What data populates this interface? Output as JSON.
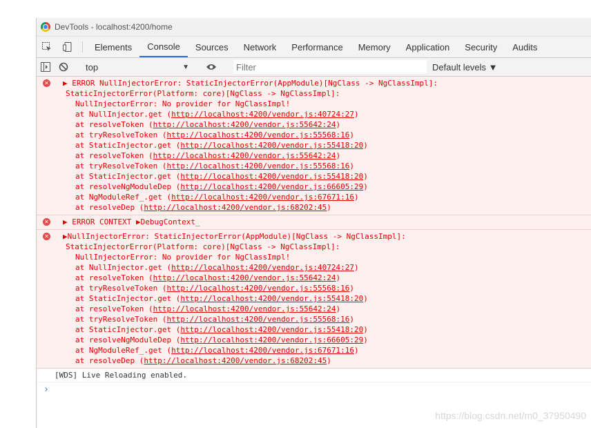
{
  "window": {
    "title": "DevTools - localhost:4200/home"
  },
  "tabs": [
    "Elements",
    "Console",
    "Sources",
    "Network",
    "Performance",
    "Memory",
    "Application",
    "Security",
    "Audits"
  ],
  "active_tab": "Console",
  "toolbar": {
    "context": "top",
    "filter_placeholder": "Filter",
    "levels": "Default levels ▼"
  },
  "messages": [
    {
      "head": "▶ ERROR NullInjectorError: StaticInjectorError(AppModule)[NgClass -> NgClassImpl]:",
      "line2": "StaticInjectorError(Platform: core)[NgClass -> NgClassImpl]:",
      "line3": "NullInjectorError: No provider for NgClassImpl!",
      "stack": [
        {
          "fn": "at NullInjector.get (",
          "url": "http://localhost:4200/vendor.js:40724:27",
          "end": ")"
        },
        {
          "fn": "at resolveToken (",
          "url": "http://localhost:4200/vendor.js:55642:24",
          "end": ")"
        },
        {
          "fn": "at tryResolveToken (",
          "url": "http://localhost:4200/vendor.js:55568:16",
          "end": ")"
        },
        {
          "fn": "at StaticInjector.get (",
          "url": "http://localhost:4200/vendor.js:55418:20",
          "end": ")"
        },
        {
          "fn": "at resolveToken (",
          "url": "http://localhost:4200/vendor.js:55642:24",
          "end": ")"
        },
        {
          "fn": "at tryResolveToken (",
          "url": "http://localhost:4200/vendor.js:55568:16",
          "end": ")"
        },
        {
          "fn": "at StaticInjector.get (",
          "url": "http://localhost:4200/vendor.js:55418:20",
          "end": ")"
        },
        {
          "fn": "at resolveNgModuleDep (",
          "url": "http://localhost:4200/vendor.js:66605:29",
          "end": ")"
        },
        {
          "fn": "at NgModuleRef_.get (",
          "url": "http://localhost:4200/vendor.js:67671:16",
          "end": ")"
        },
        {
          "fn": "at resolveDep (",
          "url": "http://localhost:4200/vendor.js:68202:45",
          "end": ")"
        }
      ]
    },
    {
      "head": "▶ ERROR CONTEXT ▶DebugContext_"
    },
    {
      "head": "▶NullInjectorError: StaticInjectorError(AppModule)[NgClass -> NgClassImpl]:",
      "line2": "StaticInjectorError(Platform: core)[NgClass -> NgClassImpl]:",
      "line3": "NullInjectorError: No provider for NgClassImpl!",
      "stack": [
        {
          "fn": "at NullInjector.get (",
          "url": "http://localhost:4200/vendor.js:40724:27",
          "end": ")"
        },
        {
          "fn": "at resolveToken (",
          "url": "http://localhost:4200/vendor.js:55642:24",
          "end": ")"
        },
        {
          "fn": "at tryResolveToken (",
          "url": "http://localhost:4200/vendor.js:55568:16",
          "end": ")"
        },
        {
          "fn": "at StaticInjector.get (",
          "url": "http://localhost:4200/vendor.js:55418:20",
          "end": ")"
        },
        {
          "fn": "at resolveToken (",
          "url": "http://localhost:4200/vendor.js:55642:24",
          "end": ")"
        },
        {
          "fn": "at tryResolveToken (",
          "url": "http://localhost:4200/vendor.js:55568:16",
          "end": ")"
        },
        {
          "fn": "at StaticInjector.get (",
          "url": "http://localhost:4200/vendor.js:55418:20",
          "end": ")"
        },
        {
          "fn": "at resolveNgModuleDep (",
          "url": "http://localhost:4200/vendor.js:66605:29",
          "end": ")"
        },
        {
          "fn": "at NgModuleRef_.get (",
          "url": "http://localhost:4200/vendor.js:67671:16",
          "end": ")"
        },
        {
          "fn": "at resolveDep (",
          "url": "http://localhost:4200/vendor.js:68202:45",
          "end": ")"
        }
      ]
    }
  ],
  "info": "[WDS] Live Reloading enabled.",
  "prompt": "›",
  "watermark": "https://blog.csdn.net/m0_37950490"
}
